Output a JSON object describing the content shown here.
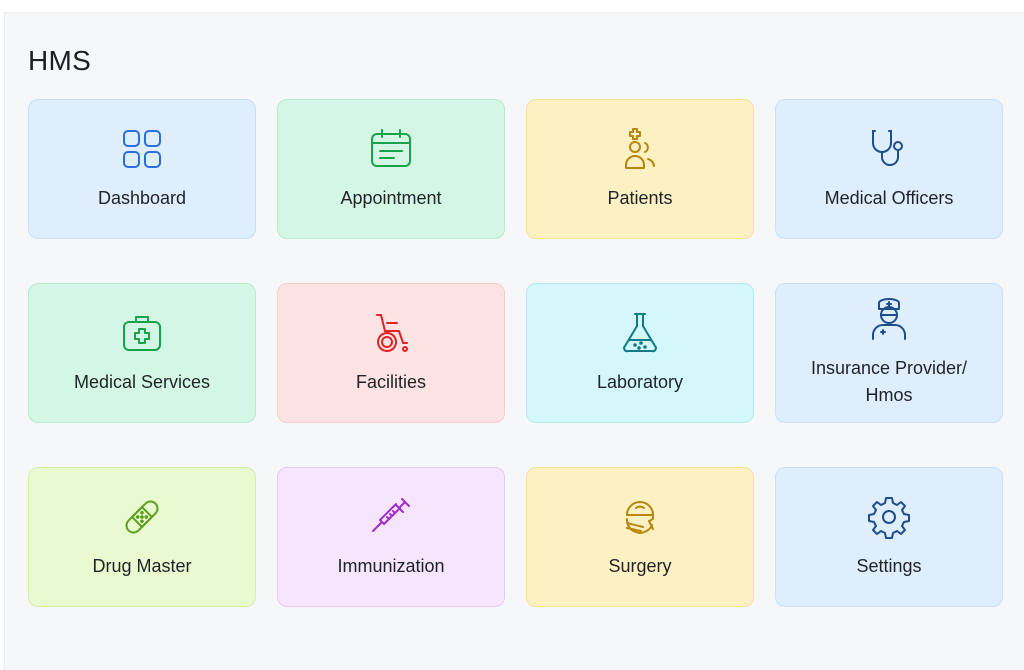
{
  "app": {
    "title": "HMS"
  },
  "colors": {
    "blue": "#2a6fdb",
    "green": "#16a34a",
    "amber": "#b8860b",
    "navy": "#1e4e8c",
    "red": "#e02424",
    "teal": "#0e7c86",
    "lime": "#5a9e1b",
    "purple": "#a22bc9"
  },
  "tiles": [
    {
      "label": "Dashboard",
      "icon": "grid-icon"
    },
    {
      "label": "Appointment",
      "icon": "calendar-icon"
    },
    {
      "label": "Patients",
      "icon": "patients-icon"
    },
    {
      "label": "Medical Officers",
      "icon": "stethoscope-icon"
    },
    {
      "label": "Medical Services",
      "icon": "medical-kit-icon"
    },
    {
      "label": "Facilities",
      "icon": "wheelchair-icon"
    },
    {
      "label": "Laboratory",
      "icon": "flask-icon"
    },
    {
      "label": "Insurance Provider/ Hmos",
      "icon": "nurse-icon"
    },
    {
      "label": "Drug Master",
      "icon": "bandage-icon"
    },
    {
      "label": "Immunization",
      "icon": "syringe-icon"
    },
    {
      "label": "Surgery",
      "icon": "surgeon-icon"
    },
    {
      "label": "Settings",
      "icon": "gear-icon"
    }
  ]
}
